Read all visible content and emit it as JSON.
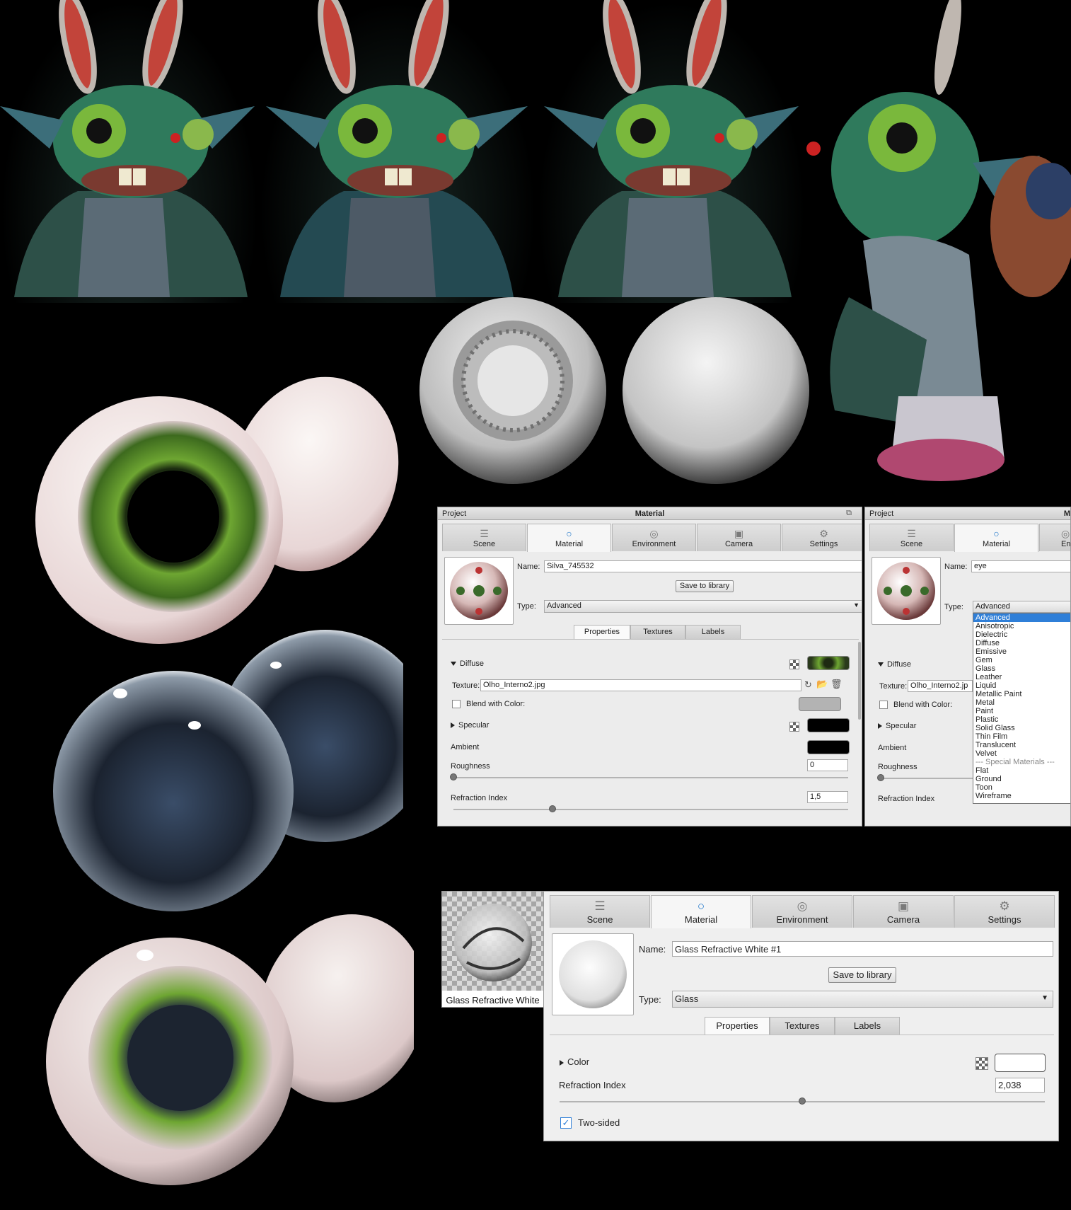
{
  "panel1": {
    "title_left": "Project",
    "title_center": "Material",
    "tabs": [
      {
        "label": "Scene",
        "icon": "list-icon"
      },
      {
        "label": "Material",
        "icon": "material-icon",
        "active": true
      },
      {
        "label": "Environment",
        "icon": "globe-icon"
      },
      {
        "label": "Camera",
        "icon": "camera-icon"
      },
      {
        "label": "Settings",
        "icon": "gear-icon"
      }
    ],
    "name_label": "Name:",
    "name_value": "Silva_745532",
    "save_label": "Save to library",
    "type_label": "Type:",
    "type_value": "Advanced",
    "subtabs": [
      "Properties",
      "Textures",
      "Labels"
    ],
    "diffuse_label": "Diffuse",
    "texture_label": "Texture:",
    "texture_value": "Olho_Interno2.jpg",
    "blend_label": "Blend with Color:",
    "specular_label": "Specular",
    "ambient_label": "Ambient",
    "roughness_label": "Roughness",
    "roughness_value": "0",
    "roughness_fraction": 0.0,
    "refraction_label": "Refraction Index",
    "refraction_value": "1,5",
    "refraction_fraction": 0.25
  },
  "panel2": {
    "title_left": "Project",
    "title_center": "M",
    "tabs": [
      {
        "label": "Scene",
        "icon": "list-icon"
      },
      {
        "label": "Material",
        "icon": "material-icon",
        "active": true
      },
      {
        "label": "Env",
        "icon": "globe-icon"
      }
    ],
    "name_label": "Name:",
    "name_value": "eye",
    "type_label": "Type:",
    "type_value": "Advanced",
    "diffuse_label": "Diffuse",
    "texture_label": "Texture:",
    "texture_value": "Olho_Interno2.jp",
    "blend_label": "Blend with Color:",
    "specular_label": "Specular",
    "ambient_label": "Ambient",
    "roughness_label": "Roughness",
    "refraction_label": "Refraction Index",
    "type_options": [
      "Advanced",
      "Anisotropic",
      "Dielectric",
      "Diffuse",
      "Emissive",
      "Gem",
      "Glass",
      "Leather",
      "Liquid",
      "Metallic Paint",
      "Metal",
      "Paint",
      "Plastic",
      "Solid Glass",
      "Thin Film",
      "Translucent",
      "Velvet",
      "--- Special Materials ---",
      "Flat",
      "Ground",
      "Toon",
      "Wireframe"
    ],
    "selected_option": "Advanced"
  },
  "library_thumb": {
    "label": "Glass Refractive White"
  },
  "panel3": {
    "tabs": [
      {
        "label": "Scene",
        "icon": "list-icon"
      },
      {
        "label": "Material",
        "icon": "material-icon",
        "active": true
      },
      {
        "label": "Environment",
        "icon": "globe-icon"
      },
      {
        "label": "Camera",
        "icon": "camera-icon"
      },
      {
        "label": "Settings",
        "icon": "gear-icon"
      }
    ],
    "name_label": "Name:",
    "name_value": "Glass Refractive White #1",
    "save_label": "Save to library",
    "type_label": "Type:",
    "type_value": "Glass",
    "subtabs": [
      "Properties",
      "Textures",
      "Labels"
    ],
    "color_label": "Color",
    "refraction_label": "Refraction Index",
    "refraction_value": "2,038",
    "refraction_fraction": 0.5,
    "twosided_label": "Two-sided",
    "twosided_checked": true
  },
  "colors": {
    "accent": "#1a73c9",
    "selection": "#2f7fd8"
  }
}
